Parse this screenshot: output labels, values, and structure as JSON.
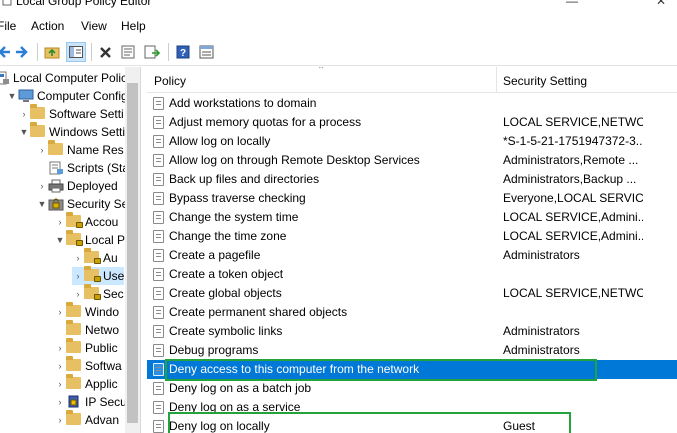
{
  "window": {
    "title": "Local Group Policy Editor"
  },
  "menu": {
    "file": "File",
    "action": "Action",
    "view": "View",
    "help": "Help"
  },
  "tree": {
    "items": [
      {
        "label": "Local Computer Polic",
        "level": 0,
        "arrow": ""
      },
      {
        "label": "Computer Config",
        "level": 0,
        "arrow": "▼"
      },
      {
        "label": "Software Setti",
        "level": 1,
        "arrow": "›"
      },
      {
        "label": "Windows Setti",
        "level": 1,
        "arrow": "▼"
      },
      {
        "label": "Name Res",
        "level": 2,
        "arrow": "›"
      },
      {
        "label": "Scripts (Sta",
        "level": 2,
        "arrow": ""
      },
      {
        "label": "Deployed",
        "level": 2,
        "arrow": "›"
      },
      {
        "label": "Security Se",
        "level": 2,
        "arrow": "▼"
      },
      {
        "label": "Accou",
        "level": 3,
        "arrow": "›"
      },
      {
        "label": "Local P",
        "level": 3,
        "arrow": "▼"
      },
      {
        "label": "Au",
        "level": 4,
        "arrow": "›"
      },
      {
        "label": "Use",
        "level": 4,
        "arrow": "›"
      },
      {
        "label": "Sec",
        "level": 4,
        "arrow": "›"
      },
      {
        "label": "Windo",
        "level": 3,
        "arrow": "›"
      },
      {
        "label": "Netwo",
        "level": 3,
        "arrow": ""
      },
      {
        "label": "Public",
        "level": 3,
        "arrow": "›"
      },
      {
        "label": "Softwa",
        "level": 3,
        "arrow": "›"
      },
      {
        "label": "Applic",
        "level": 3,
        "arrow": "›"
      },
      {
        "label": "IP Secu",
        "level": 3,
        "arrow": "›"
      },
      {
        "label": "Advan",
        "level": 3,
        "arrow": "›"
      }
    ]
  },
  "list": {
    "columns": {
      "policy": "Policy",
      "setting": "Security Setting"
    },
    "rows": [
      {
        "policy": "Add workstations to domain",
        "setting": ""
      },
      {
        "policy": "Adjust memory quotas for a process",
        "setting": "LOCAL SERVICE,NETWO..."
      },
      {
        "policy": "Allow log on locally",
        "setting": "*S-1-5-21-1751947372-3..."
      },
      {
        "policy": "Allow log on through Remote Desktop Services",
        "setting": "Administrators,Remote ..."
      },
      {
        "policy": "Back up files and directories",
        "setting": "Administrators,Backup ..."
      },
      {
        "policy": "Bypass traverse checking",
        "setting": "Everyone,LOCAL SERVIC..."
      },
      {
        "policy": "Change the system time",
        "setting": "LOCAL SERVICE,Admini..."
      },
      {
        "policy": "Change the time zone",
        "setting": "LOCAL SERVICE,Admini..."
      },
      {
        "policy": "Create a pagefile",
        "setting": "Administrators"
      },
      {
        "policy": "Create a token object",
        "setting": ""
      },
      {
        "policy": "Create global objects",
        "setting": "LOCAL SERVICE,NETWO..."
      },
      {
        "policy": "Create permanent shared objects",
        "setting": ""
      },
      {
        "policy": "Create symbolic links",
        "setting": "Administrators"
      },
      {
        "policy": "Debug programs",
        "setting": "Administrators"
      },
      {
        "policy": "Deny access to this computer from the network",
        "setting": ""
      },
      {
        "policy": "Deny log on as a batch job",
        "setting": ""
      },
      {
        "policy": "Deny log on as a service",
        "setting": ""
      },
      {
        "policy": "Deny log on locally",
        "setting": "Guest"
      }
    ]
  },
  "colors": {
    "selection": "#0078d7",
    "highlight_box": "#22a33c",
    "folder": "#e8c064"
  }
}
